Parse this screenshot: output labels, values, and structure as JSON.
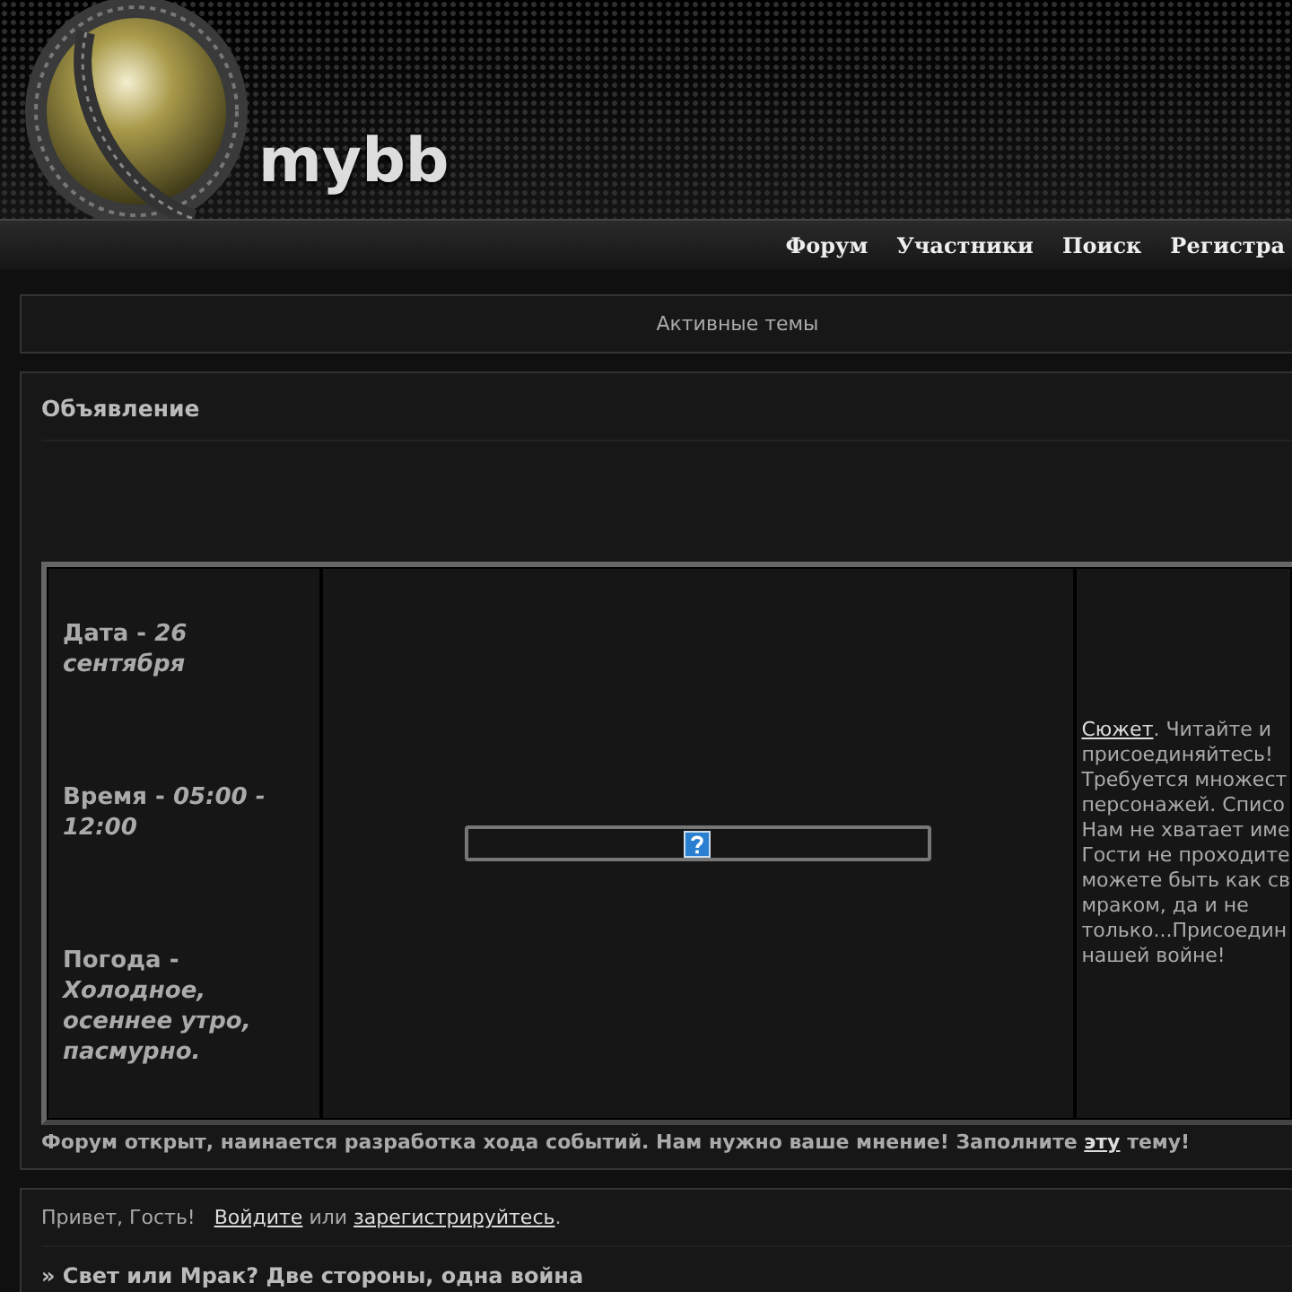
{
  "header": {
    "logo_text": "mybb",
    "nav": [
      "Форум",
      "Участники",
      "Поиск",
      "Регистра"
    ]
  },
  "active_topics": "Активные темы",
  "announcement": {
    "title": "Объявление",
    "info": [
      {
        "label": "Дата - ",
        "value": "26 сентября"
      },
      {
        "label": "Время - ",
        "value": "05:00 - 12:00"
      },
      {
        "label": "Погода - ",
        "value": "Холодное, осеннее утро, пасмурно."
      }
    ],
    "right": {
      "link": "Сюжет",
      "lines": [
        ". Читайте и",
        "присоединяйтесь!",
        "Требуется множест",
        "персонажей. Списо",
        "Нам не хватает име",
        "Гости не проходите",
        "можете быть как св",
        "мраком, да и не",
        "только...Присоедин",
        "нашей войне!"
      ]
    },
    "footer": {
      "before": "Форум открыт, наинается разработка хода событий. Нам нужно ваше мнение! Заполните ",
      "link": "эту",
      "after": " тему!"
    }
  },
  "guest": {
    "greeting": "Привет, Гость!",
    "login": "Войдите",
    "or": " или ",
    "register": "зарегистрируйтесь",
    "end": "."
  },
  "topic": "» Свет или Мрак? Две стороны, одна война"
}
